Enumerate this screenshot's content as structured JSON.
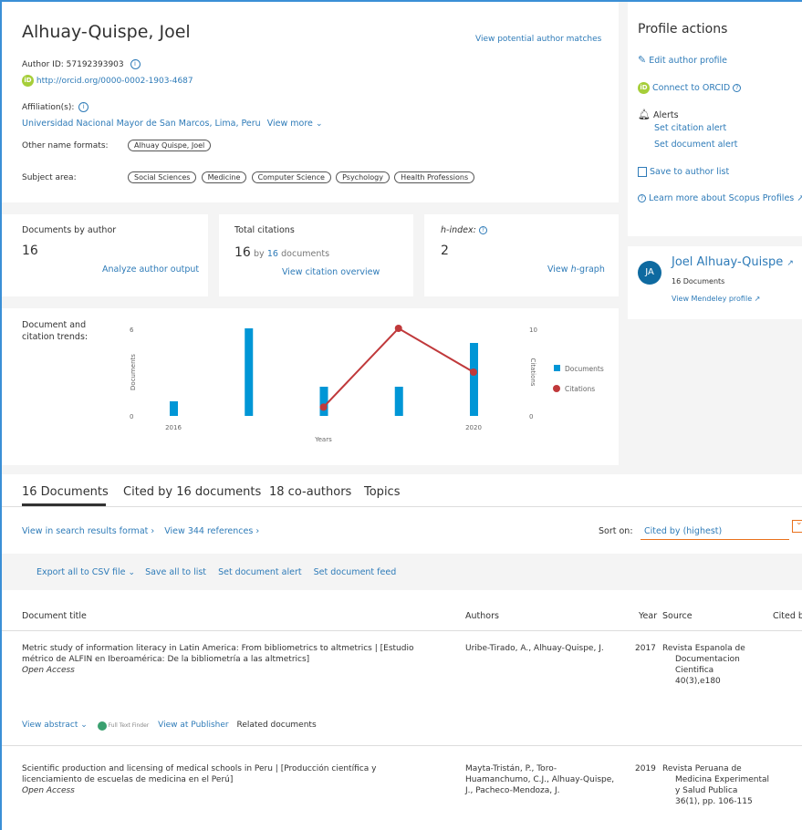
{
  "author": {
    "name": "Alhuay-Quispe, Joel",
    "author_id_label": "Author ID: 57192393903",
    "orcid_url": "http://orcid.org/0000-0002-1903-4687",
    "affiliation_label": "Affiliation(s):",
    "affiliation": "Universidad Nacional Mayor de San Marcos, Lima, Peru",
    "view_more": "View more",
    "other_names_label": "Other name formats:",
    "other_names": [
      "Alhuay Quispe, Joel"
    ],
    "subject_area_label": "Subject area:",
    "subject_areas": [
      "Social Sciences",
      "Medicine",
      "Computer Science",
      "Psychology",
      "Health Professions"
    ],
    "view_matches": "View potential author matches"
  },
  "metrics": {
    "documents_label": "Documents by author",
    "documents_value": "16",
    "analyze_link": "Analyze author output",
    "citations_label": "Total citations",
    "citations_value": "16",
    "citations_by": "by",
    "citations_docs_link": "16",
    "citations_docs_suffix": "documents",
    "citation_overview_link": "View citation overview",
    "hindex_label": "h-index:",
    "hindex_value": "2",
    "hgraph_link_prefix": "View",
    "hgraph_link_h": "h",
    "hgraph_link_suffix": "-graph"
  },
  "profile_actions": {
    "title": "Profile actions",
    "edit": "Edit author profile",
    "connect_orcid": "Connect to ORCID",
    "alerts_label": "Alerts",
    "citation_alert": "Set citation alert",
    "document_alert": "Set document alert",
    "save_list": "Save to author list",
    "learn_more": "Learn more about Scopus Profiles"
  },
  "mendeley": {
    "initials": "JA",
    "name": "Joel Alhuay-Quispe",
    "docs": "16 Documents",
    "link": "View Mendeley profile"
  },
  "chart_data": {
    "type": "bar",
    "title": "Document and citation trends:",
    "xlabel": "Years",
    "ylabel": "Documents",
    "y2label": "Citations",
    "x": [
      2016,
      2017,
      2018,
      2019,
      2020
    ],
    "x_tick_labels": [
      "2016",
      "2020"
    ],
    "ylim": [
      0,
      6
    ],
    "y_ticks": [
      "0",
      "6"
    ],
    "y2lim": [
      0,
      10
    ],
    "y2_ticks": [
      "0",
      "10"
    ],
    "series": [
      {
        "name": "Documents",
        "type": "bar",
        "color": "#0096d6",
        "values": [
          1,
          6,
          2,
          2,
          5
        ]
      },
      {
        "name": "Citations",
        "type": "line",
        "color": "#c0393b",
        "values": [
          null,
          null,
          1,
          10,
          5
        ]
      }
    ],
    "legend": "right"
  },
  "tabs": [
    "16 Documents",
    "Cited by 16 documents",
    "18 co-authors",
    "Topics"
  ],
  "results_toolbar": {
    "search_format": "View in search results format",
    "references": "View 344 references",
    "sort_label": "Sort on:",
    "sort_value": "Cited by (highest)"
  },
  "doc_actions": {
    "export": "Export all to CSV file",
    "save_all": "Save all to list",
    "set_alert": "Set document alert",
    "set_feed": "Set document feed"
  },
  "table": {
    "headers": {
      "title": "Document title",
      "authors": "Authors",
      "year": "Year",
      "source": "Source",
      "cited": "Cited b"
    },
    "rows": [
      {
        "title_lines": [
          "Metric study of information literacy in Latin America: From bibliometrics to altmetrics | [Estudio",
          "métrico de ALFIN en Iberoamérica: De la bibliometría a las altmetrics]"
        ],
        "access": "Open Access",
        "authors_lines": [
          "Uribe-Tirado, A., Alhuay-Quispe, J."
        ],
        "year": "2017",
        "source_lines": [
          "Revista Espanola de",
          "Documentacion",
          "Cientifica",
          "40(3),e180"
        ]
      },
      {
        "title_lines": [
          "Scientific production and licensing of medical schools in Peru | [Producción científica y",
          "licenciamiento de escuelas de medicina en el Perú]"
        ],
        "access": "Open Access",
        "authors_lines": [
          "Mayta-Tristán, P., Toro-",
          "Huamanchumo, C.J., Alhuay-Quispe,",
          "J., Pacheco-Mendoza, J."
        ],
        "year": "2019",
        "source_lines": [
          "Revista Peruana de",
          "Medicina Experimental",
          "y Salud Publica",
          "36(1), pp. 106-115"
        ]
      }
    ],
    "row_links": {
      "view_abstract": "View abstract",
      "fulltext": "Full Text Finder",
      "view_publisher": "View at Publisher",
      "related": "Related documents"
    }
  }
}
